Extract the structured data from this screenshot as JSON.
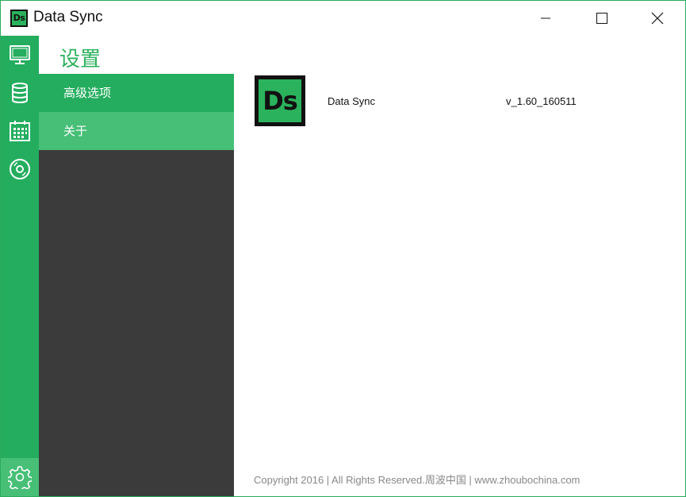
{
  "window": {
    "title": "Data Sync",
    "logo_text": "Ds"
  },
  "rail": {
    "items": [
      {
        "icon": "monitor-icon"
      },
      {
        "icon": "database-icon"
      },
      {
        "icon": "calendar-icon"
      },
      {
        "icon": "disc-icon"
      }
    ],
    "bottom_icon": "settings-gear-icon"
  },
  "settings": {
    "title": "设置",
    "menu": [
      {
        "label": "高级选项"
      },
      {
        "label": "关于"
      }
    ]
  },
  "about": {
    "logo_text": "Ds",
    "app_name": "Data Sync",
    "version": "v_1.60_160511",
    "footer": "Copyright 2016 | All Rights Reserved.周波中国  | www.zhoubochina.com"
  },
  "colors": {
    "accent": "#24ad5e",
    "accent_light": "#47bf77",
    "dark_panel": "#3b3b3b"
  }
}
